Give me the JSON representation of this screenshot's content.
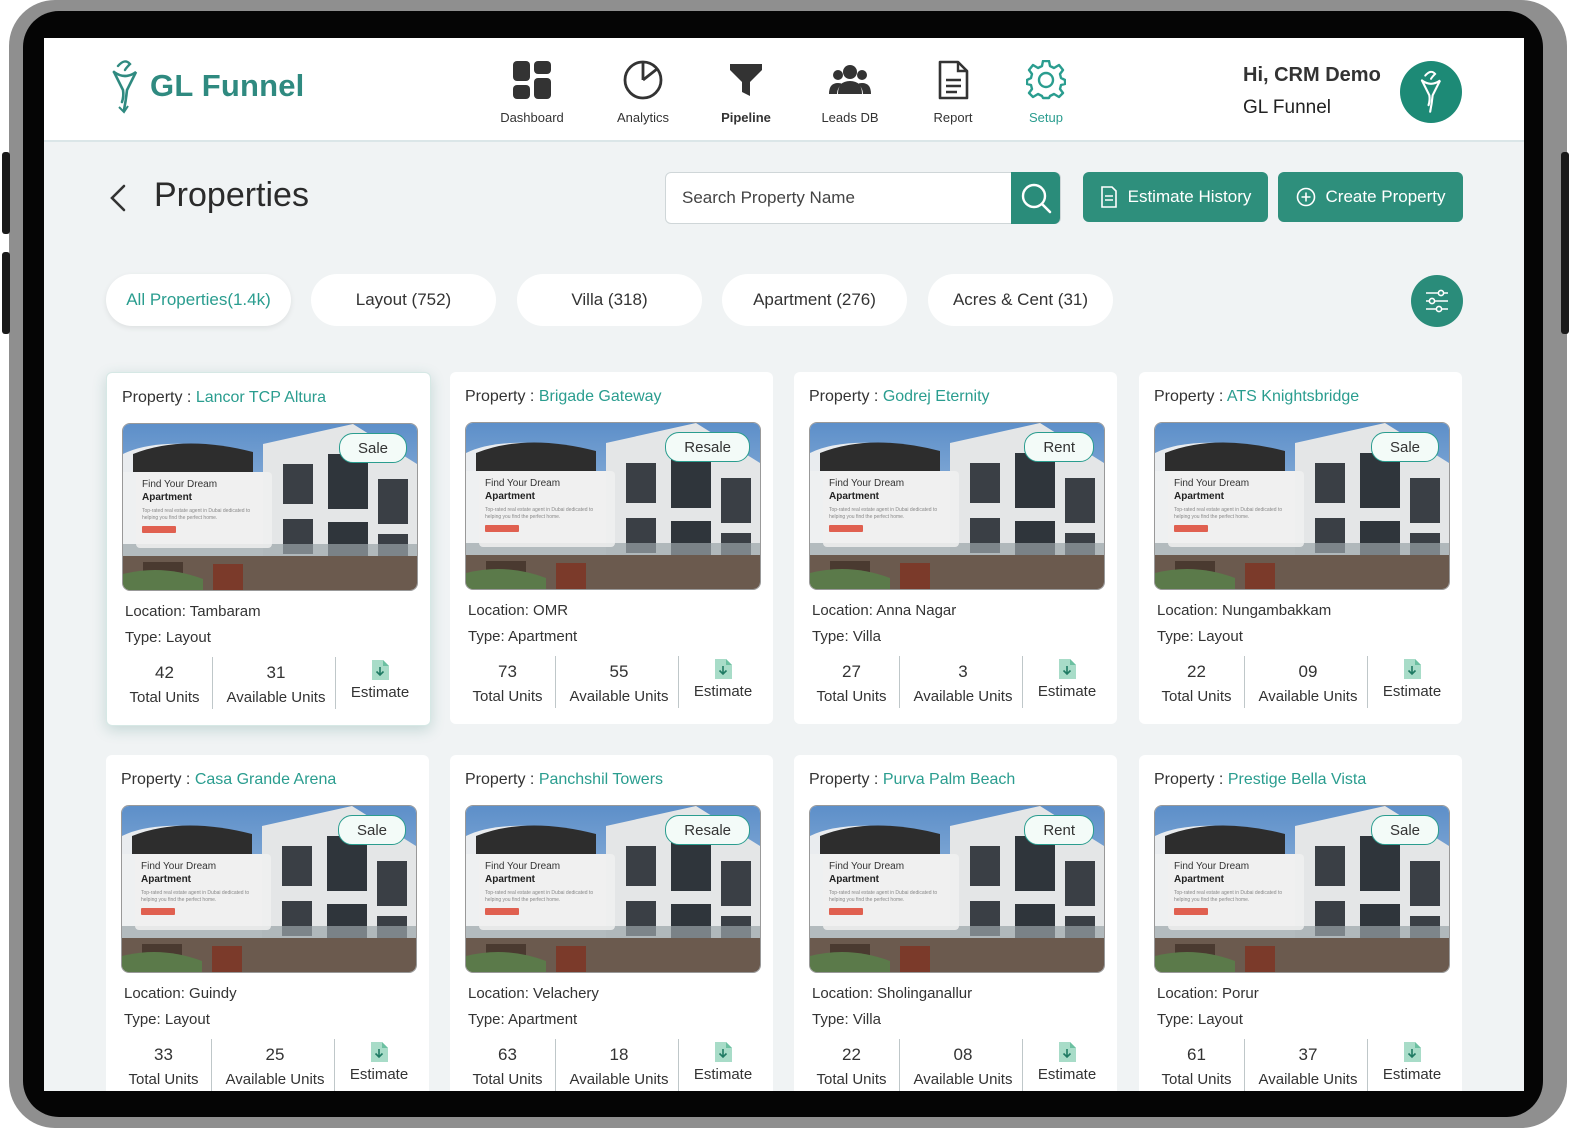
{
  "app": {
    "brand": "GL Funnel",
    "user_greeting": "Hi, CRM Demo",
    "user_org": "GL Funnel"
  },
  "nav": [
    {
      "label": "Dashboard",
      "icon": "dashboard-icon"
    },
    {
      "label": "Analytics",
      "icon": "analytics-icon"
    },
    {
      "label": "Pipeline",
      "icon": "pipeline-icon"
    },
    {
      "label": "Leads DB",
      "icon": "leads-icon"
    },
    {
      "label": "Report",
      "icon": "report-icon"
    },
    {
      "label": "Setup",
      "icon": "setup-icon",
      "active": true
    }
  ],
  "page": {
    "title": "Properties",
    "search_placeholder": "Search Property Name",
    "estimate_history_label": "Estimate History",
    "create_property_label": "Create Property"
  },
  "filters": [
    {
      "label": "All Properties(1.4k)",
      "active": true
    },
    {
      "label": "Layout (752)"
    },
    {
      "label": "Villa (318)"
    },
    {
      "label": "Apartment (276)"
    },
    {
      "label": "Acres & Cent (31)"
    }
  ],
  "card_labels": {
    "property_prefix": "Property : ",
    "total_units": "Total Units",
    "available_units": "Available Units",
    "estimate": "Estimate",
    "promo_line1": "Find Your Dream",
    "promo_line2": "Apartment",
    "promo_line3": "Top-rated real estate agent in Dubai dedicated to helping you find the perfect home."
  },
  "properties": [
    {
      "name": "Lancor TCP Altura",
      "tag": "Sale",
      "location": "Location: Tambaram",
      "type": "Type: Layout",
      "total": "42",
      "available": "31"
    },
    {
      "name": "Brigade Gateway",
      "tag": "Resale",
      "location": "Location: OMR",
      "type": "Type: Apartment",
      "total": "73",
      "available": "55"
    },
    {
      "name": "Godrej Eternity",
      "tag": "Rent",
      "location": "Location: Anna Nagar",
      "type": "Type: Villa",
      "total": "27",
      "available": "3"
    },
    {
      "name": "ATS Knightsbridge",
      "tag": "Sale",
      "location": "Location: Nungambakkam",
      "type": "Type: Layout",
      "total": "22",
      "available": "09"
    },
    {
      "name": "Casa Grande Arena",
      "tag": "Sale",
      "location": "Location: Guindy",
      "type": "Type: Layout",
      "total": "33",
      "available": "25"
    },
    {
      "name": "Panchshil Towers",
      "tag": "Resale",
      "location": "Location: Velachery",
      "type": "Type: Apartment",
      "total": "63",
      "available": "18"
    },
    {
      "name": "Purva Palm Beach",
      "tag": "Rent",
      "location": "Location: Sholinganallur",
      "type": "Type: Villa",
      "total": "22",
      "available": "08"
    },
    {
      "name": "Prestige Bella Vista",
      "tag": "Sale",
      "location": "Location: Porur",
      "type": "Type: Layout",
      "total": "61",
      "available": "37"
    }
  ],
  "colors": {
    "accent": "#2a9d8f",
    "button": "#2e8f7c",
    "background": "#f0f3f4"
  }
}
